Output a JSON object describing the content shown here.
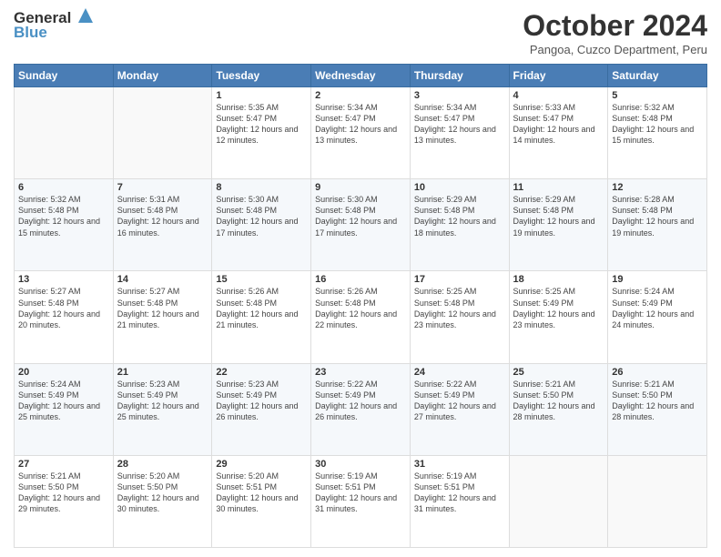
{
  "header": {
    "logo_line1": "General",
    "logo_line2": "Blue",
    "month_title": "October 2024",
    "subtitle": "Pangoa, Cuzco Department, Peru"
  },
  "weekdays": [
    "Sunday",
    "Monday",
    "Tuesday",
    "Wednesday",
    "Thursday",
    "Friday",
    "Saturday"
  ],
  "weeks": [
    [
      {
        "day": "",
        "sunrise": "",
        "sunset": "",
        "daylight": ""
      },
      {
        "day": "",
        "sunrise": "",
        "sunset": "",
        "daylight": ""
      },
      {
        "day": "1",
        "sunrise": "Sunrise: 5:35 AM",
        "sunset": "Sunset: 5:47 PM",
        "daylight": "Daylight: 12 hours and 12 minutes."
      },
      {
        "day": "2",
        "sunrise": "Sunrise: 5:34 AM",
        "sunset": "Sunset: 5:47 PM",
        "daylight": "Daylight: 12 hours and 13 minutes."
      },
      {
        "day": "3",
        "sunrise": "Sunrise: 5:34 AM",
        "sunset": "Sunset: 5:47 PM",
        "daylight": "Daylight: 12 hours and 13 minutes."
      },
      {
        "day": "4",
        "sunrise": "Sunrise: 5:33 AM",
        "sunset": "Sunset: 5:47 PM",
        "daylight": "Daylight: 12 hours and 14 minutes."
      },
      {
        "day": "5",
        "sunrise": "Sunrise: 5:32 AM",
        "sunset": "Sunset: 5:48 PM",
        "daylight": "Daylight: 12 hours and 15 minutes."
      }
    ],
    [
      {
        "day": "6",
        "sunrise": "Sunrise: 5:32 AM",
        "sunset": "Sunset: 5:48 PM",
        "daylight": "Daylight: 12 hours and 15 minutes."
      },
      {
        "day": "7",
        "sunrise": "Sunrise: 5:31 AM",
        "sunset": "Sunset: 5:48 PM",
        "daylight": "Daylight: 12 hours and 16 minutes."
      },
      {
        "day": "8",
        "sunrise": "Sunrise: 5:30 AM",
        "sunset": "Sunset: 5:48 PM",
        "daylight": "Daylight: 12 hours and 17 minutes."
      },
      {
        "day": "9",
        "sunrise": "Sunrise: 5:30 AM",
        "sunset": "Sunset: 5:48 PM",
        "daylight": "Daylight: 12 hours and 17 minutes."
      },
      {
        "day": "10",
        "sunrise": "Sunrise: 5:29 AM",
        "sunset": "Sunset: 5:48 PM",
        "daylight": "Daylight: 12 hours and 18 minutes."
      },
      {
        "day": "11",
        "sunrise": "Sunrise: 5:29 AM",
        "sunset": "Sunset: 5:48 PM",
        "daylight": "Daylight: 12 hours and 19 minutes."
      },
      {
        "day": "12",
        "sunrise": "Sunrise: 5:28 AM",
        "sunset": "Sunset: 5:48 PM",
        "daylight": "Daylight: 12 hours and 19 minutes."
      }
    ],
    [
      {
        "day": "13",
        "sunrise": "Sunrise: 5:27 AM",
        "sunset": "Sunset: 5:48 PM",
        "daylight": "Daylight: 12 hours and 20 minutes."
      },
      {
        "day": "14",
        "sunrise": "Sunrise: 5:27 AM",
        "sunset": "Sunset: 5:48 PM",
        "daylight": "Daylight: 12 hours and 21 minutes."
      },
      {
        "day": "15",
        "sunrise": "Sunrise: 5:26 AM",
        "sunset": "Sunset: 5:48 PM",
        "daylight": "Daylight: 12 hours and 21 minutes."
      },
      {
        "day": "16",
        "sunrise": "Sunrise: 5:26 AM",
        "sunset": "Sunset: 5:48 PM",
        "daylight": "Daylight: 12 hours and 22 minutes."
      },
      {
        "day": "17",
        "sunrise": "Sunrise: 5:25 AM",
        "sunset": "Sunset: 5:48 PM",
        "daylight": "Daylight: 12 hours and 23 minutes."
      },
      {
        "day": "18",
        "sunrise": "Sunrise: 5:25 AM",
        "sunset": "Sunset: 5:49 PM",
        "daylight": "Daylight: 12 hours and 23 minutes."
      },
      {
        "day": "19",
        "sunrise": "Sunrise: 5:24 AM",
        "sunset": "Sunset: 5:49 PM",
        "daylight": "Daylight: 12 hours and 24 minutes."
      }
    ],
    [
      {
        "day": "20",
        "sunrise": "Sunrise: 5:24 AM",
        "sunset": "Sunset: 5:49 PM",
        "daylight": "Daylight: 12 hours and 25 minutes."
      },
      {
        "day": "21",
        "sunrise": "Sunrise: 5:23 AM",
        "sunset": "Sunset: 5:49 PM",
        "daylight": "Daylight: 12 hours and 25 minutes."
      },
      {
        "day": "22",
        "sunrise": "Sunrise: 5:23 AM",
        "sunset": "Sunset: 5:49 PM",
        "daylight": "Daylight: 12 hours and 26 minutes."
      },
      {
        "day": "23",
        "sunrise": "Sunrise: 5:22 AM",
        "sunset": "Sunset: 5:49 PM",
        "daylight": "Daylight: 12 hours and 26 minutes."
      },
      {
        "day": "24",
        "sunrise": "Sunrise: 5:22 AM",
        "sunset": "Sunset: 5:49 PM",
        "daylight": "Daylight: 12 hours and 27 minutes."
      },
      {
        "day": "25",
        "sunrise": "Sunrise: 5:21 AM",
        "sunset": "Sunset: 5:50 PM",
        "daylight": "Daylight: 12 hours and 28 minutes."
      },
      {
        "day": "26",
        "sunrise": "Sunrise: 5:21 AM",
        "sunset": "Sunset: 5:50 PM",
        "daylight": "Daylight: 12 hours and 28 minutes."
      }
    ],
    [
      {
        "day": "27",
        "sunrise": "Sunrise: 5:21 AM",
        "sunset": "Sunset: 5:50 PM",
        "daylight": "Daylight: 12 hours and 29 minutes."
      },
      {
        "day": "28",
        "sunrise": "Sunrise: 5:20 AM",
        "sunset": "Sunset: 5:50 PM",
        "daylight": "Daylight: 12 hours and 30 minutes."
      },
      {
        "day": "29",
        "sunrise": "Sunrise: 5:20 AM",
        "sunset": "Sunset: 5:51 PM",
        "daylight": "Daylight: 12 hours and 30 minutes."
      },
      {
        "day": "30",
        "sunrise": "Sunrise: 5:19 AM",
        "sunset": "Sunset: 5:51 PM",
        "daylight": "Daylight: 12 hours and 31 minutes."
      },
      {
        "day": "31",
        "sunrise": "Sunrise: 5:19 AM",
        "sunset": "Sunset: 5:51 PM",
        "daylight": "Daylight: 12 hours and 31 minutes."
      },
      {
        "day": "",
        "sunrise": "",
        "sunset": "",
        "daylight": ""
      },
      {
        "day": "",
        "sunrise": "",
        "sunset": "",
        "daylight": ""
      }
    ]
  ]
}
